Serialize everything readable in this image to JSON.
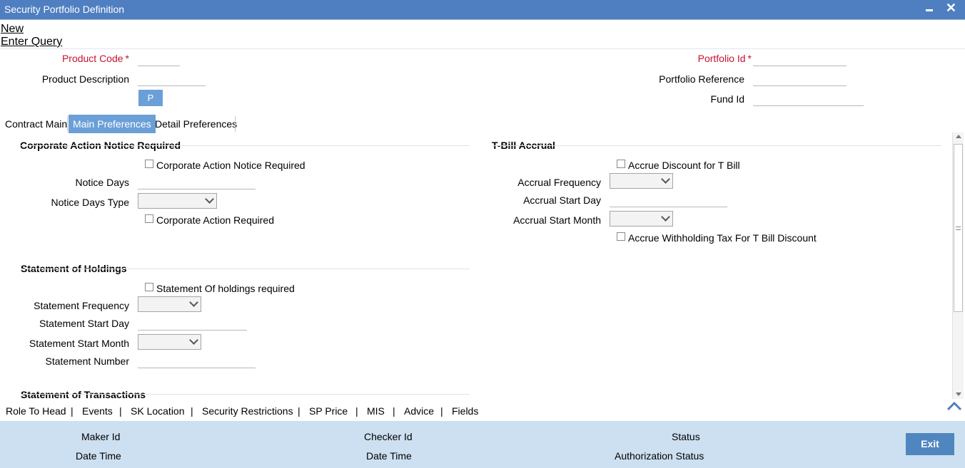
{
  "window": {
    "title": "Security Portfolio Definition"
  },
  "toolbar": {
    "new": "New",
    "enter_query": "Enter Query"
  },
  "header": {
    "product_code": "Product Code",
    "product_description": "Product Description",
    "p_button": "P",
    "portfolio_id": "Portfolio Id",
    "portfolio_reference": "Portfolio Reference",
    "fund_id": "Fund Id",
    "required_marker": "*"
  },
  "tabs": [
    "Contract Main",
    "Main Preferences",
    "Detail Preferences"
  ],
  "active_tab": "Main Preferences",
  "corporate_action": {
    "heading": "Corporate Action Notice Required",
    "notice_required": "Corporate Action Notice Required",
    "notice_days": "Notice Days",
    "notice_days_type": "Notice Days Type",
    "action_required": "Corporate Action Required"
  },
  "tbill": {
    "heading": "T-Bill Accrual",
    "accrue_discount": "Accrue Discount for T Bill",
    "accrual_frequency": "Accrual Frequency",
    "accrual_start_day": "Accrual Start Day",
    "accrual_start_month": "Accrual Start Month",
    "accrue_withholding": "Accrue Withholding Tax For T Bill Discount"
  },
  "holdings": {
    "heading": "Statement of Holdings",
    "required": "Statement Of holdings required",
    "frequency": "Statement Frequency",
    "start_day": "Statement Start Day",
    "start_month": "Statement Start Month",
    "number": "Statement Number"
  },
  "transactions": {
    "heading": "Statement of Transactions"
  },
  "bottom_links": [
    "Role To Head",
    "Events",
    "SK Location",
    "Security Restrictions",
    "SP Price",
    "MIS",
    "Advice",
    "Fields"
  ],
  "link_separator": "|",
  "footer": {
    "maker_id": "Maker Id",
    "date_time_1": "Date Time",
    "checker_id": "Checker Id",
    "date_time_2": "Date Time",
    "status": "Status",
    "authorization_status": "Authorization Status",
    "exit": "Exit"
  }
}
